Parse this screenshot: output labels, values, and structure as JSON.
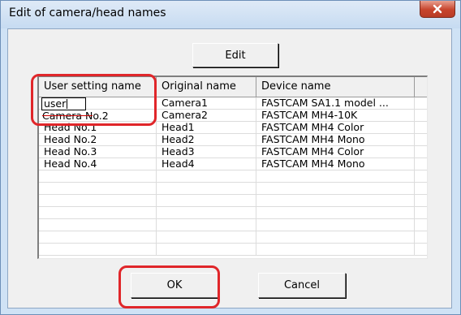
{
  "window": {
    "title": "Edit of camera/head names",
    "close_icon": "close-icon"
  },
  "toolbar": {
    "edit_label": "Edit"
  },
  "grid": {
    "columns": [
      "User setting name",
      "Original name",
      "Device name",
      ""
    ],
    "editing_value": "user",
    "overflow_text": "Camera No.2",
    "rows": [
      {
        "user": "",
        "original": "Camera1",
        "device": "FASTCAM SA1.1 model ..."
      },
      {
        "user": "",
        "original": "Camera2",
        "device": "FASTCAM MH4-10K"
      },
      {
        "user": "Head No.1",
        "original": "Head1",
        "device": "FASTCAM MH4 Color"
      },
      {
        "user": "Head No.2",
        "original": "Head2",
        "device": "FASTCAM MH4 Mono"
      },
      {
        "user": "Head No.3",
        "original": "Head3",
        "device": "FASTCAM MH4 Color"
      },
      {
        "user": "Head No.4",
        "original": "Head4",
        "device": "FASTCAM MH4 Mono"
      },
      {
        "user": "",
        "original": "",
        "device": ""
      },
      {
        "user": "",
        "original": "",
        "device": ""
      },
      {
        "user": "",
        "original": "",
        "device": ""
      },
      {
        "user": "",
        "original": "",
        "device": ""
      },
      {
        "user": "",
        "original": "",
        "device": ""
      },
      {
        "user": "",
        "original": "",
        "device": ""
      },
      {
        "user": "",
        "original": "",
        "device": ""
      }
    ]
  },
  "footer": {
    "ok_label": "OK",
    "cancel_label": "Cancel"
  },
  "colors": {
    "highlight": "#e0262a",
    "close_button": "#c7442c"
  }
}
